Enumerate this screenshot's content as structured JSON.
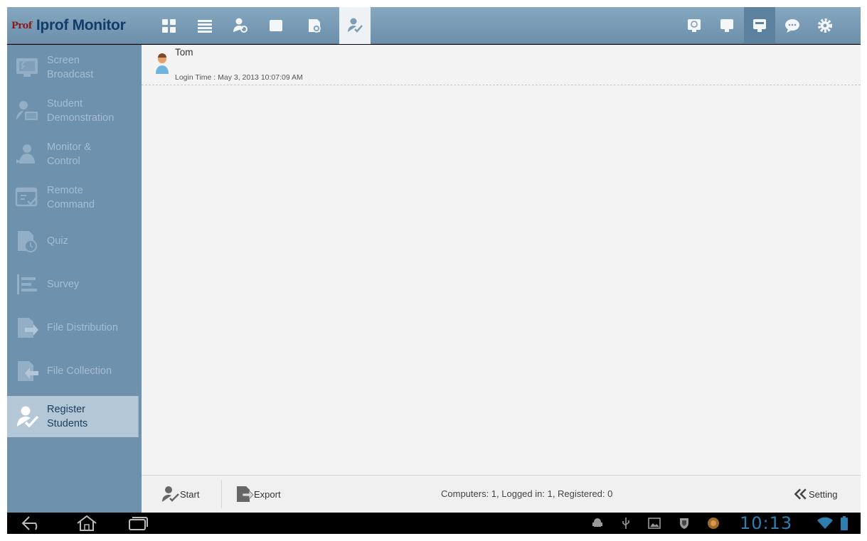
{
  "app": {
    "logo_text": "Prof",
    "title": "Iprof Monitor"
  },
  "toolbar": {
    "left_buttons": [
      {
        "icon": "grid-view-icon"
      },
      {
        "icon": "list-view-icon"
      },
      {
        "icon": "students-icon"
      },
      {
        "icon": "blank-screen-icon"
      },
      {
        "icon": "quiz-icon"
      },
      {
        "icon": "register-students-icon",
        "active": true
      }
    ],
    "right_buttons": [
      {
        "icon": "broadcast-monitor-icon"
      },
      {
        "icon": "monitor-icon"
      },
      {
        "icon": "monitor-selected-icon",
        "active": true
      },
      {
        "icon": "chat-icon"
      },
      {
        "icon": "gear-icon"
      }
    ]
  },
  "sidebar": {
    "items": [
      {
        "line1": "Screen",
        "line2": "Broadcast",
        "icon": "screen-broadcast-icon"
      },
      {
        "line1": "Student",
        "line2": "Demonstration",
        "icon": "student-demonstration-icon"
      },
      {
        "line1": "Monitor &",
        "line2": "Control",
        "icon": "monitor-control-icon"
      },
      {
        "line1": "Remote",
        "line2": "Command",
        "icon": "remote-command-icon"
      },
      {
        "line1": "Quiz",
        "line2": "",
        "icon": "quiz-icon"
      },
      {
        "line1": "Survey",
        "line2": "",
        "icon": "survey-icon"
      },
      {
        "line1": "File Distribution",
        "line2": "",
        "icon": "file-distribution-icon"
      },
      {
        "line1": "File Collection",
        "line2": "",
        "icon": "file-collection-icon"
      },
      {
        "line1": "Register",
        "line2": "Students",
        "icon": "register-students-icon",
        "active": true
      }
    ]
  },
  "students": [
    {
      "name": "Tom",
      "login_time": "Login Time : May 3, 2013 10:07:09 AM"
    }
  ],
  "bottom_bar": {
    "start_label": "Start",
    "export_label": "Export",
    "status": "Computers: 1, Logged in: 1, Registered: 0",
    "setting_label": "Setting"
  },
  "system_bar": {
    "clock": "10:13",
    "icons": [
      "back-icon",
      "home-icon",
      "recent-apps-icon",
      "android-debug-icon",
      "usb-icon",
      "image-icon",
      "shield-icon",
      "app-icon",
      "wifi-icon",
      "battery-icon"
    ]
  },
  "colors": {
    "topbar": "#7a9db8",
    "sidebar": "#6e91ad",
    "sidebar_active": "#b4c7d6",
    "title": "#123d6a",
    "clock": "#2d7fb0"
  }
}
